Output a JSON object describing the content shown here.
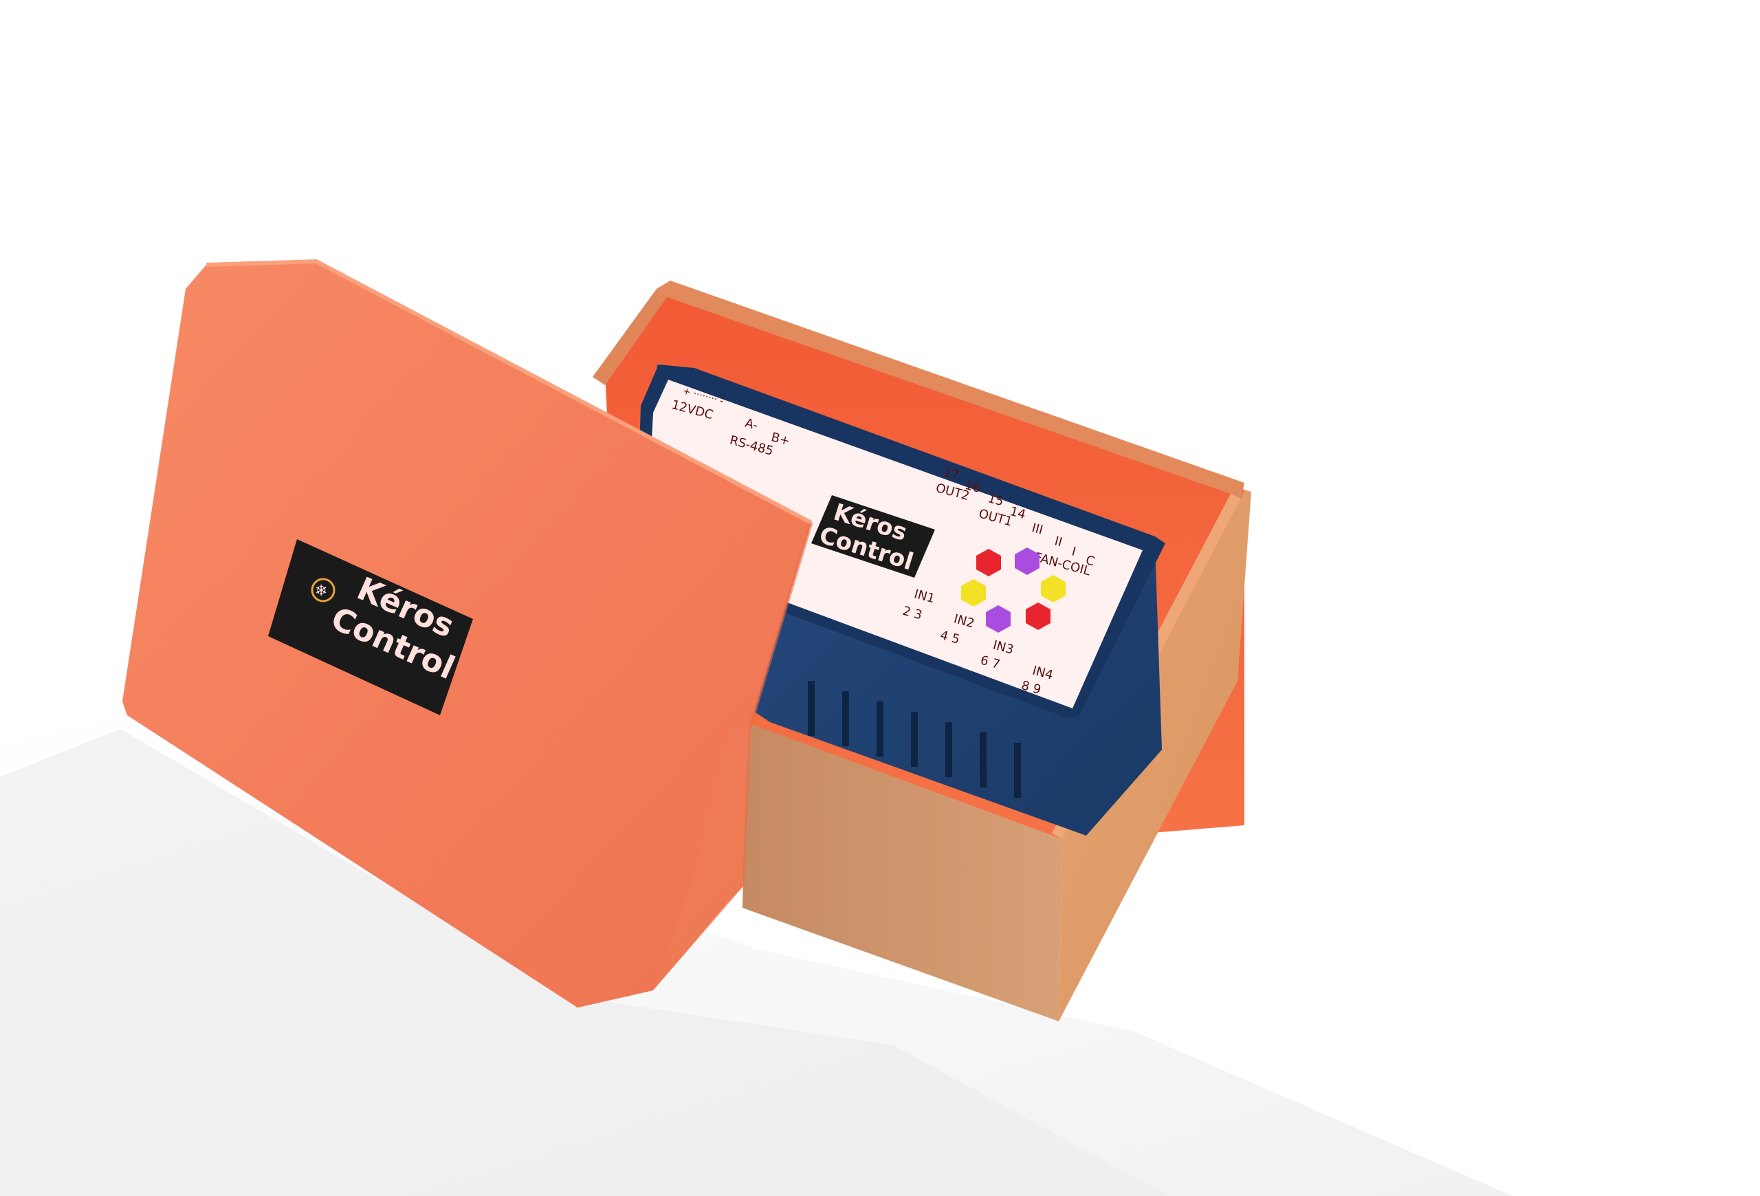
{
  "colors": {
    "background": "#ffffff",
    "lid": "#f47e5c",
    "box_outer": "#d79868",
    "box_inner": "#f55f3c",
    "device_frame": "#1d3f6e",
    "device_label": "#fff4f2",
    "badge": "#1a1a1a",
    "badge_text": "#ffe0dc",
    "hex_red": "#e8242e",
    "hex_purple": "#a94ce0",
    "hex_yellow": "#f3e125"
  },
  "lid_badge": {
    "line1": "Kéros",
    "line2": "Control",
    "icon": "fan-snowflake-icon"
  },
  "device": {
    "badge_line1": "Kéros",
    "badge_line2": "Control",
    "power_pol": "+ ········ -",
    "power": "12VDC",
    "rs485_a": "A-",
    "rs485_b": "B+",
    "rs485": "RS-485",
    "out_terminals": [
      "17",
      "16",
      "15",
      "14"
    ],
    "out2": "OUT2",
    "out1": "OUT1",
    "fan_terminals": [
      "III",
      "II",
      "I",
      "C"
    ],
    "fan_coil": "FAN-COIL",
    "inputs": [
      {
        "label": "IN1",
        "pins": "2  3"
      },
      {
        "label": "IN2",
        "pins": "4  5"
      },
      {
        "label": "IN3",
        "pins": "6  7"
      },
      {
        "label": "IN4",
        "pins": "8  9"
      }
    ]
  }
}
